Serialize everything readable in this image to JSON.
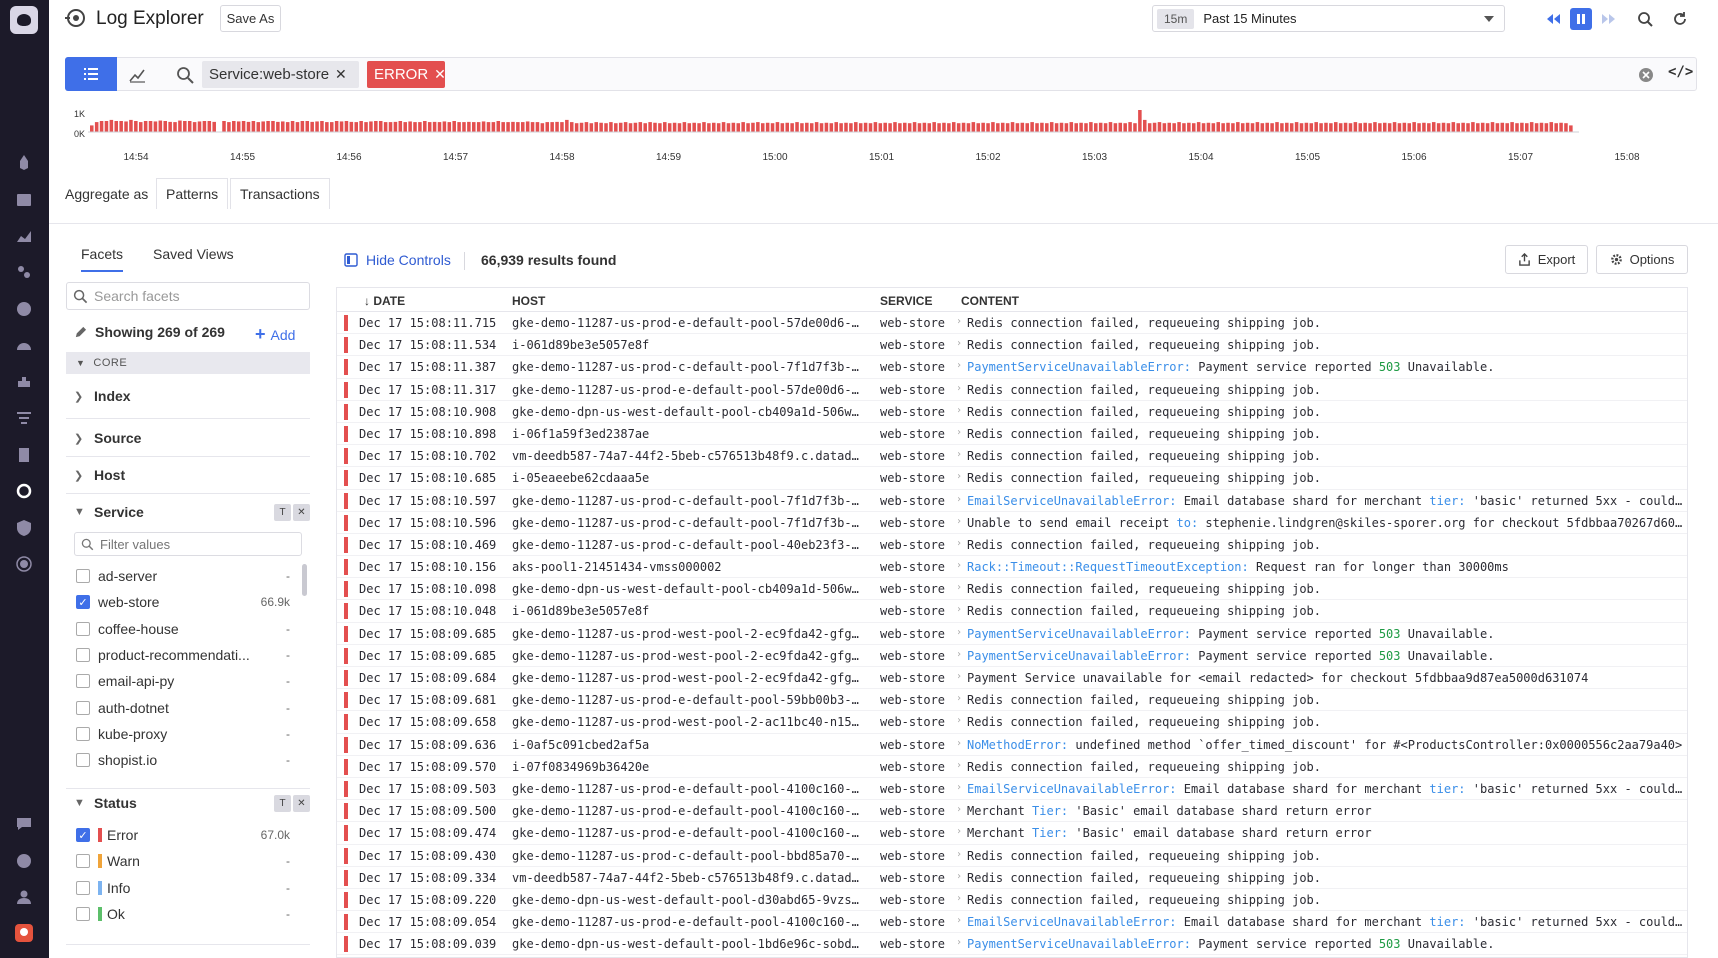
{
  "header": {
    "title": "Log Explorer",
    "save_as": "Save As",
    "time_chip": "15m",
    "time_range": "Past 15 Minutes"
  },
  "search": {
    "tags": [
      {
        "label": "Service:web-store",
        "color": "#e7e7ec"
      },
      {
        "label": "ERROR",
        "color": "#e34f4f"
      }
    ],
    "remove_glyph": "✕"
  },
  "histogram": {
    "y_ticks": [
      "1K",
      "0K"
    ],
    "x_ticks": [
      "14:54",
      "14:55",
      "14:56",
      "14:57",
      "14:58",
      "14:59",
      "15:00",
      "15:01",
      "15:02",
      "15:03",
      "15:04",
      "15:05",
      "15:06",
      "15:07",
      "15:08"
    ],
    "bar_color": "#e34f4f",
    "values": [
      0.3,
      0.45,
      0.5,
      0.5,
      0.55,
      0.5,
      0.5,
      0.48,
      0.55,
      0.5,
      0.45,
      0.5,
      0.5,
      0.48,
      0.52,
      0.5,
      0.46,
      0.45,
      0.52,
      0.5,
      0.5,
      0.45,
      0.48,
      0.5,
      0.5,
      0.46,
      0.0,
      0.5,
      0.45,
      0.5,
      0.48,
      0.5,
      0.46,
      0.5,
      0.45,
      0.48,
      0.5,
      0.5,
      0.46,
      0.48,
      0.45,
      0.5,
      0.45,
      0.5,
      0.5,
      0.46,
      0.48,
      0.5,
      0.45,
      0.45,
      0.5,
      0.48,
      0.5,
      0.46,
      0.45,
      0.5,
      0.45,
      0.48,
      0.5,
      0.5,
      0.45,
      0.45,
      0.46,
      0.5,
      0.45,
      0.48,
      0.45,
      0.45,
      0.5,
      0.45,
      0.46,
      0.45,
      0.48,
      0.45,
      0.5,
      0.45,
      0.45,
      0.46,
      0.45,
      0.45,
      0.48,
      0.45,
      0.45,
      0.5,
      0.45,
      0.45,
      0.46,
      0.45,
      0.45,
      0.48,
      0.45,
      0.45,
      0.4,
      0.45,
      0.45,
      0.46,
      0.45,
      0.55,
      0.45,
      0.4,
      0.42,
      0.45,
      0.4,
      0.45,
      0.42,
      0.4,
      0.45,
      0.4,
      0.42,
      0.45,
      0.4,
      0.42,
      0.45,
      0.4,
      0.45,
      0.42,
      0.4,
      0.45,
      0.4,
      0.42,
      0.4,
      0.45,
      0.4,
      0.42,
      0.4,
      0.45,
      0.4,
      0.42,
      0.4,
      0.45,
      0.4,
      0.42,
      0.4,
      0.45,
      0.4,
      0.42,
      0.45,
      0.4,
      0.42,
      0.4,
      0.45,
      0.4,
      0.42,
      0.4,
      0.45,
      0.4,
      0.42,
      0.4,
      0.45,
      0.4,
      0.42,
      0.4,
      0.45,
      0.4,
      0.42,
      0.4,
      0.45,
      0.4,
      0.42,
      0.4,
      0.45,
      0.4,
      0.42,
      0.4,
      0.45,
      0.4,
      0.42,
      0.4,
      0.45,
      0.4,
      0.42,
      0.4,
      0.45,
      0.4,
      0.42,
      0.4,
      0.45,
      0.4,
      0.42,
      0.4,
      0.45,
      0.4,
      0.42,
      0.4,
      0.45,
      0.4,
      0.42,
      0.4,
      0.45,
      0.4,
      0.42,
      0.4,
      0.45,
      0.4,
      0.42,
      0.4,
      0.45,
      0.4,
      0.42,
      0.4,
      0.45,
      0.4,
      0.42,
      0.4,
      0.45,
      0.4,
      0.42,
      0.4,
      0.45,
      0.4,
      0.42,
      0.4,
      0.45,
      0.4,
      1.0,
      0.55,
      0.4,
      0.42,
      0.45,
      0.4,
      0.42,
      0.4,
      0.45,
      0.4,
      0.42,
      0.4,
      0.45,
      0.4,
      0.42,
      0.4,
      0.45,
      0.4,
      0.42,
      0.4,
      0.45,
      0.4,
      0.42,
      0.4,
      0.45,
      0.4,
      0.42,
      0.4,
      0.45,
      0.4,
      0.42,
      0.4,
      0.45,
      0.4,
      0.42,
      0.4,
      0.45,
      0.4,
      0.42,
      0.4,
      0.45,
      0.4,
      0.42,
      0.4,
      0.45,
      0.4,
      0.42,
      0.4,
      0.45,
      0.4,
      0.42,
      0.4,
      0.45,
      0.4,
      0.42,
      0.4,
      0.45,
      0.4,
      0.42,
      0.4,
      0.45,
      0.4,
      0.42,
      0.4,
      0.45,
      0.4,
      0.42,
      0.4,
      0.45,
      0.4,
      0.42,
      0.4,
      0.45,
      0.4,
      0.42,
      0.4,
      0.45,
      0.4,
      0.42,
      0.4,
      0.45,
      0.4,
      0.42,
      0.4,
      0.45,
      0.4,
      0.42,
      0.4,
      0.3
    ]
  },
  "aggregate": {
    "label": "Aggregate as",
    "tabs": [
      "Patterns",
      "Transactions"
    ]
  },
  "facets": {
    "tabs": [
      "Facets",
      "Saved Views"
    ],
    "search_placeholder": "Search facets",
    "showing": "Showing 269 of 269",
    "add_label": "Add",
    "core_label": "CORE",
    "groups": [
      "Index",
      "Source",
      "Host",
      "Service",
      "Status"
    ],
    "filter_placeholder": "Filter values",
    "service_values": [
      {
        "label": "ad-server",
        "count": "-",
        "checked": false
      },
      {
        "label": "web-store",
        "count": "66.9k",
        "checked": true
      },
      {
        "label": "coffee-house",
        "count": "-",
        "checked": false
      },
      {
        "label": "product-recommendati...",
        "count": "-",
        "checked": false
      },
      {
        "label": "email-api-py",
        "count": "-",
        "checked": false
      },
      {
        "label": "auth-dotnet",
        "count": "-",
        "checked": false
      },
      {
        "label": "kube-proxy",
        "count": "-",
        "checked": false
      },
      {
        "label": "shopist.io",
        "count": "-",
        "checked": false
      }
    ],
    "status_values": [
      {
        "label": "Error",
        "count": "67.0k",
        "checked": true,
        "color": "#e34f4f"
      },
      {
        "label": "Warn",
        "count": "-",
        "checked": false,
        "color": "#f0a43a"
      },
      {
        "label": "Info",
        "count": "-",
        "checked": false,
        "color": "#7cb3f0"
      },
      {
        "label": "Ok",
        "count": "-",
        "checked": false,
        "color": "#5cbf6a"
      }
    ],
    "tool_filter": "T",
    "tool_close": "✕"
  },
  "results": {
    "hide_controls": "Hide Controls",
    "count": "66,939 results found",
    "export": "Export",
    "options": "Options",
    "columns": {
      "date": "DATE",
      "host": "HOST",
      "service": "SERVICE",
      "content": "CONTENT"
    },
    "rows": [
      {
        "date": "Dec 17 15:08:11.715",
        "host": "gke-demo-11287-us-prod-e-default-pool-57de00d6-i...",
        "service": "web-store",
        "content": [
          {
            "t": "Redis connection failed, requeueing shipping job."
          }
        ]
      },
      {
        "date": "Dec 17 15:08:11.534",
        "host": "i-061d89be3e5057e8f",
        "service": "web-store",
        "content": [
          {
            "t": "Redis connection failed, requeueing shipping job."
          }
        ]
      },
      {
        "date": "Dec 17 15:08:11.387",
        "host": "gke-demo-11287-us-prod-c-default-pool-7f1d7f3b-c...",
        "service": "web-store",
        "content": [
          {
            "t": "PaymentServiceUnavailableError:",
            "c": "err"
          },
          {
            "t": " Payment service reported "
          },
          {
            "t": "503",
            "c": "num"
          },
          {
            "t": " Unavailable."
          }
        ]
      },
      {
        "date": "Dec 17 15:08:11.317",
        "host": "gke-demo-11287-us-prod-e-default-pool-57de00d6-i...",
        "service": "web-store",
        "content": [
          {
            "t": "Redis connection failed, requeueing shipping job."
          }
        ]
      },
      {
        "date": "Dec 17 15:08:10.908",
        "host": "gke-demo-dpn-us-west-default-pool-cb409a1d-506w...",
        "service": "web-store",
        "content": [
          {
            "t": "Redis connection failed, requeueing shipping job."
          }
        ]
      },
      {
        "date": "Dec 17 15:08:10.898",
        "host": "i-06f1a59f3ed2387ae",
        "service": "web-store",
        "content": [
          {
            "t": "Redis connection failed, requeueing shipping job."
          }
        ]
      },
      {
        "date": "Dec 17 15:08:10.702",
        "host": "vm-deedb587-74a7-44f2-5beb-c576513b48f9.c.datado...",
        "service": "web-store",
        "content": [
          {
            "t": "Redis connection failed, requeueing shipping job."
          }
        ]
      },
      {
        "date": "Dec 17 15:08:10.685",
        "host": "i-05eaeebe62cdaaa5e",
        "service": "web-store",
        "content": [
          {
            "t": "Redis connection failed, requeueing shipping job."
          }
        ]
      },
      {
        "date": "Dec 17 15:08:10.597",
        "host": "gke-demo-11287-us-prod-c-default-pool-7f1d7f3b-3...",
        "service": "web-store",
        "content": [
          {
            "t": "EmailServiceUnavailableError:",
            "c": "err"
          },
          {
            "t": " Email database shard for merchant "
          },
          {
            "t": "tier:",
            "c": "err"
          },
          {
            "t": " 'basic' returned 5xx - could ..."
          }
        ]
      },
      {
        "date": "Dec 17 15:08:10.596",
        "host": "gke-demo-11287-us-prod-c-default-pool-7f1d7f3b-3...",
        "service": "web-store",
        "content": [
          {
            "t": "Unable to send email receipt "
          },
          {
            "t": "to:",
            "c": "err"
          },
          {
            "t": " stephenie.lindgren@skiles-sporer.org for checkout 5fdbbaa70267d60..."
          }
        ]
      },
      {
        "date": "Dec 17 15:08:10.469",
        "host": "gke-demo-11287-us-prod-c-default-pool-40eb23f3-q...",
        "service": "web-store",
        "content": [
          {
            "t": "Redis connection failed, requeueing shipping job."
          }
        ]
      },
      {
        "date": "Dec 17 15:08:10.156",
        "host": "aks-pool1-21451434-vmss000002",
        "service": "web-store",
        "content": [
          {
            "t": "Rack::Timeout::RequestTimeoutException:",
            "c": "err"
          },
          {
            "t": " Request ran for longer than 30000ms"
          }
        ]
      },
      {
        "date": "Dec 17 15:08:10.098",
        "host": "gke-demo-dpn-us-west-default-pool-cb409a1d-506w...",
        "service": "web-store",
        "content": [
          {
            "t": "Redis connection failed, requeueing shipping job."
          }
        ]
      },
      {
        "date": "Dec 17 15:08:10.048",
        "host": "i-061d89be3e5057e8f",
        "service": "web-store",
        "content": [
          {
            "t": "Redis connection failed, requeueing shipping job."
          }
        ]
      },
      {
        "date": "Dec 17 15:08:09.685",
        "host": "gke-demo-11287-us-prod-west-pool-2-ec9fda42-gfgr...",
        "service": "web-store",
        "content": [
          {
            "t": "PaymentServiceUnavailableError:",
            "c": "err"
          },
          {
            "t": " Payment service reported "
          },
          {
            "t": "503",
            "c": "num"
          },
          {
            "t": " Unavailable."
          }
        ]
      },
      {
        "date": "Dec 17 15:08:09.685",
        "host": "gke-demo-11287-us-prod-west-pool-2-ec9fda42-gfgr...",
        "service": "web-store",
        "content": [
          {
            "t": "PaymentServiceUnavailableError:",
            "c": "err"
          },
          {
            "t": " Payment service reported "
          },
          {
            "t": "503",
            "c": "num"
          },
          {
            "t": " Unavailable."
          }
        ]
      },
      {
        "date": "Dec 17 15:08:09.684",
        "host": "gke-demo-11287-us-prod-west-pool-2-ec9fda42-gfgr...",
        "service": "web-store",
        "content": [
          {
            "t": "Payment Service unavailable for <email redacted> for checkout 5fdbbaa9d87ea5000d631074"
          }
        ]
      },
      {
        "date": "Dec 17 15:08:09.681",
        "host": "gke-demo-11287-us-prod-e-default-pool-59bb00b3-p...",
        "service": "web-store",
        "content": [
          {
            "t": "Redis connection failed, requeueing shipping job."
          }
        ]
      },
      {
        "date": "Dec 17 15:08:09.658",
        "host": "gke-demo-11287-us-prod-west-pool-2-ac11bc40-n159...",
        "service": "web-store",
        "content": [
          {
            "t": "Redis connection failed, requeueing shipping job."
          }
        ]
      },
      {
        "date": "Dec 17 15:08:09.636",
        "host": "i-0af5c091cbed2af5a",
        "service": "web-store",
        "content": [
          {
            "t": "NoMethodError:",
            "c": "err"
          },
          {
            "t": " undefined method `offer_timed_discount' for #<ProductsController:0x0000556c2aa79a40>"
          }
        ]
      },
      {
        "date": "Dec 17 15:08:09.570",
        "host": "i-07f0834969b36420e",
        "service": "web-store",
        "content": [
          {
            "t": "Redis connection failed, requeueing shipping job."
          }
        ]
      },
      {
        "date": "Dec 17 15:08:09.503",
        "host": "gke-demo-11287-us-prod-e-default-pool-4100c160-i...",
        "service": "web-store",
        "content": [
          {
            "t": "EmailServiceUnavailableError:",
            "c": "err"
          },
          {
            "t": " Email database shard for merchant "
          },
          {
            "t": "tier:",
            "c": "err"
          },
          {
            "t": " 'basic' returned 5xx - could ..."
          }
        ]
      },
      {
        "date": "Dec 17 15:08:09.500",
        "host": "gke-demo-11287-us-prod-e-default-pool-4100c160-i...",
        "service": "web-store",
        "content": [
          {
            "t": "Merchant "
          },
          {
            "t": "Tier:",
            "c": "err"
          },
          {
            "t": " 'Basic' email database shard return error"
          }
        ]
      },
      {
        "date": "Dec 17 15:08:09.474",
        "host": "gke-demo-11287-us-prod-e-default-pool-4100c160-u...",
        "service": "web-store",
        "content": [
          {
            "t": "Merchant "
          },
          {
            "t": "Tier:",
            "c": "err"
          },
          {
            "t": " 'Basic' email database shard return error"
          }
        ]
      },
      {
        "date": "Dec 17 15:08:09.430",
        "host": "gke-demo-11287-us-prod-c-default-pool-bbd85a70-r...",
        "service": "web-store",
        "content": [
          {
            "t": "Redis connection failed, requeueing shipping job."
          }
        ]
      },
      {
        "date": "Dec 17 15:08:09.334",
        "host": "vm-deedb587-74a7-44f2-5beb-c576513b48f9.c.datado...",
        "service": "web-store",
        "content": [
          {
            "t": "Redis connection failed, requeueing shipping job."
          }
        ]
      },
      {
        "date": "Dec 17 15:08:09.220",
        "host": "gke-demo-dpn-us-west-default-pool-d30abd65-9vzs...",
        "service": "web-store",
        "content": [
          {
            "t": "Redis connection failed, requeueing shipping job."
          }
        ]
      },
      {
        "date": "Dec 17 15:08:09.054",
        "host": "gke-demo-11287-us-prod-e-default-pool-4100c160-i...",
        "service": "web-store",
        "content": [
          {
            "t": "EmailServiceUnavailableError:",
            "c": "err"
          },
          {
            "t": " Email database shard for merchant "
          },
          {
            "t": "tier:",
            "c": "err"
          },
          {
            "t": " 'basic' returned 5xx - could ..."
          }
        ]
      },
      {
        "date": "Dec 17 15:08:09.039",
        "host": "gke-demo-dpn-us-west-default-pool-1bd6e96c-sobd...",
        "service": "web-store",
        "content": [
          {
            "t": "PaymentServiceUnavailableError:",
            "c": "err"
          },
          {
            "t": " Payment service reported "
          },
          {
            "t": "503",
            "c": "num"
          },
          {
            "t": " Unavailable."
          }
        ]
      }
    ]
  },
  "colors": {
    "accent": "#3f6fe8",
    "error": "#e34f4f",
    "nav_bg": "#1c1a29"
  }
}
